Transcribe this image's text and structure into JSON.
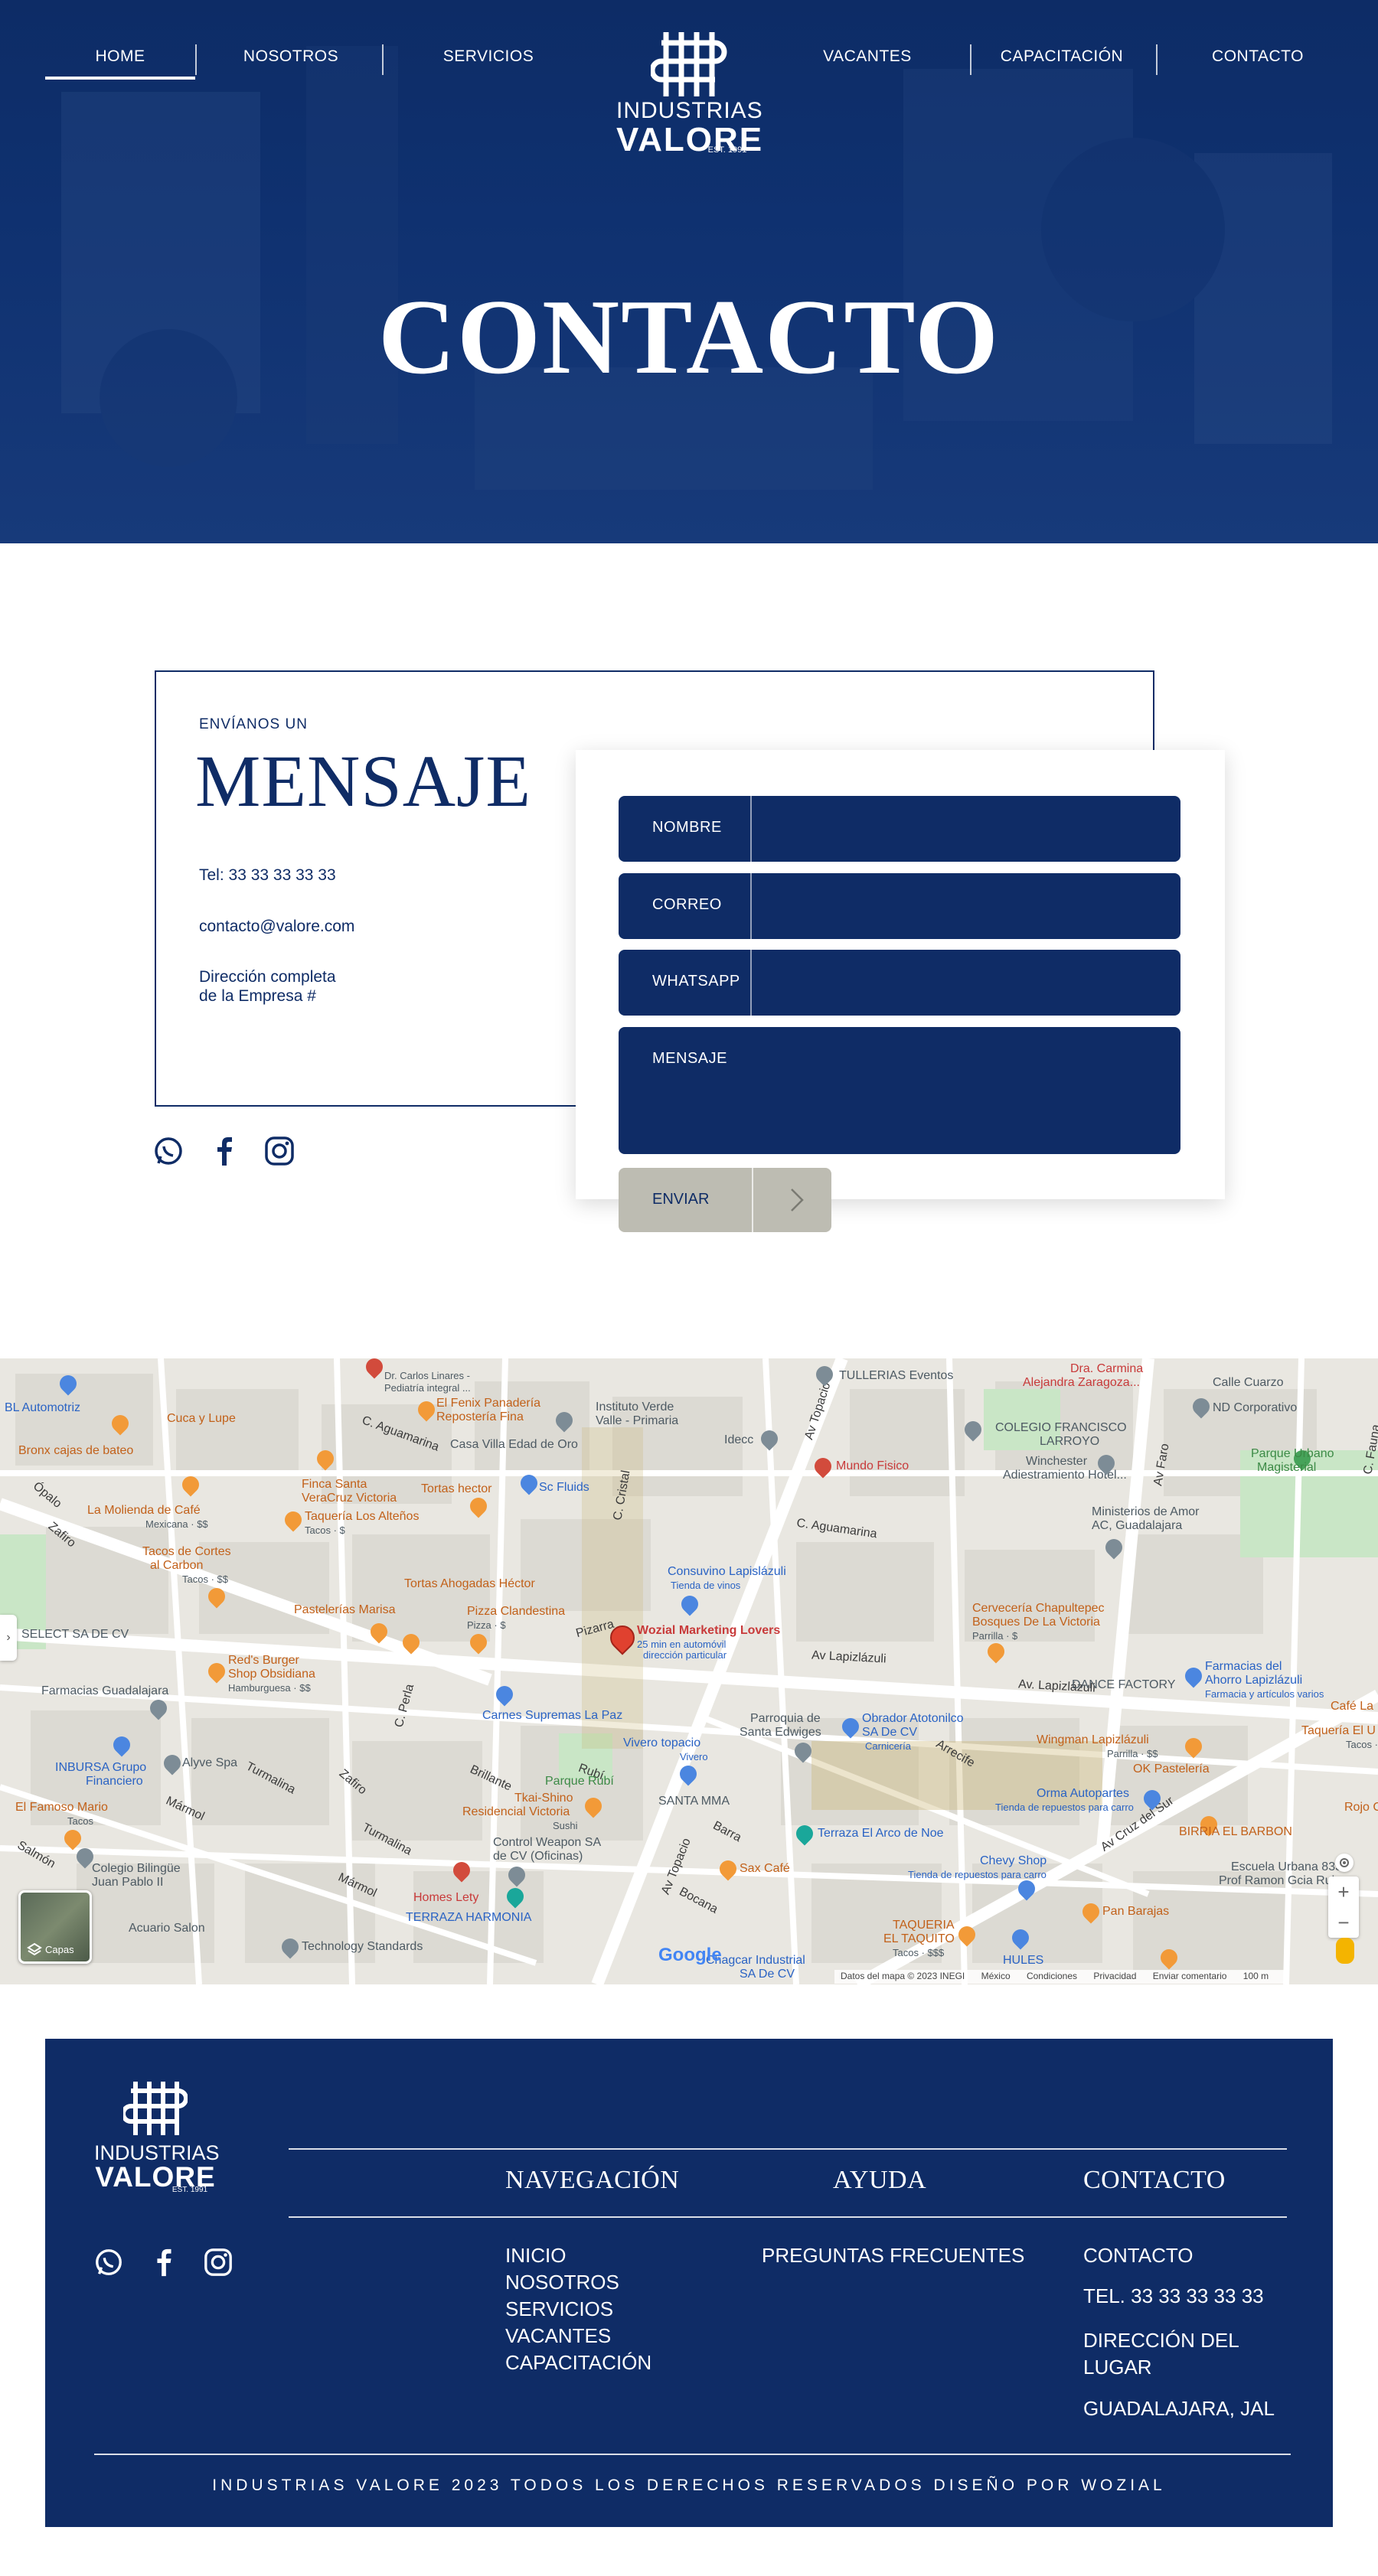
{
  "nav": {
    "items": [
      {
        "label": "HOME",
        "active": true
      },
      {
        "label": "NOSOTROS"
      },
      {
        "label": "SERVICIOS"
      },
      {
        "label": "VACANTES"
      },
      {
        "label": "CAPACITACIÓN"
      },
      {
        "label": "CONTACTO"
      }
    ]
  },
  "logo": {
    "line1": "INDUSTRIAS",
    "line2": "VALORE",
    "est": "EST. 1991"
  },
  "hero": {
    "title": "CONTACTO"
  },
  "contact": {
    "eyebrow": "ENVÍANOS UN",
    "title": "MENSAJE",
    "tel": "Tel: 33 33 33 33 33",
    "email": "contacto@valore.com",
    "address_line1": "Dirección completa",
    "address_line2": "de la Empresa #",
    "social": [
      "whatsapp-icon",
      "facebook-icon",
      "instagram-icon"
    ]
  },
  "form": {
    "fields": [
      {
        "label": "NOMBRE",
        "value": ""
      },
      {
        "label": "CORREO",
        "value": ""
      },
      {
        "label": "WHATSAPP",
        "value": ""
      },
      {
        "label": "MENSAJE",
        "value": ""
      }
    ],
    "submit": "ENVIAR"
  },
  "map": {
    "marker_title": "Wozial Marketing Lovers",
    "marker_sub1": "25 min en automóvil",
    "marker_sub2": "dirección particular",
    "layers_label": "Capas",
    "brand": "Google",
    "footer": [
      "Datos del mapa © 2023 INEGI",
      "México",
      "Condiciones",
      "Privacidad",
      "Enviar comentario",
      "100 m"
    ],
    "labels": [
      {
        "t": "Dr. Carlos Linares -",
        "c": "g"
      },
      {
        "t": "Pediatría integral ...",
        "c": "g"
      },
      {
        "t": "El Fenix Panadería",
        "c": "o"
      },
      {
        "t": "Repostería Fina",
        "c": "o"
      },
      {
        "t": "Instituto Verde",
        "c": "g"
      },
      {
        "t": "Valle - Primaria",
        "c": "g"
      },
      {
        "t": "TULLERIAS Eventos",
        "c": "g"
      },
      {
        "t": "Dra. Carmina",
        "c": "r"
      },
      {
        "t": "Alejandra Zaragoza...",
        "c": "r"
      },
      {
        "t": "Calle Cuarzo",
        "c": "g"
      },
      {
        "t": "ND Corporativo",
        "c": "g"
      },
      {
        "t": "BL Automotriz",
        "c": "b"
      },
      {
        "t": "Cuca y Lupe",
        "c": "o"
      },
      {
        "t": "Casa Villa Edad de Oro",
        "c": "g"
      },
      {
        "t": "Idecc",
        "c": "g"
      },
      {
        "t": "COLEGIO FRANCISCO",
        "c": "g"
      },
      {
        "t": "LARROYO",
        "c": "g"
      },
      {
        "t": "Parque Urbano",
        "c": "gr"
      },
      {
        "t": "Magisterial",
        "c": "gr"
      },
      {
        "t": "Bronx cajas de bateo",
        "c": "o"
      },
      {
        "t": "Mundo Fisico",
        "c": "r"
      },
      {
        "t": "Winchester",
        "c": "g"
      },
      {
        "t": "Adiestramiento Hotel...",
        "c": "g"
      },
      {
        "t": "Finca Santa",
        "c": "o"
      },
      {
        "t": "VeraCruz Victoria",
        "c": "o"
      },
      {
        "t": "Tortas hector",
        "c": "o"
      },
      {
        "t": "Sc Fluids",
        "c": "b"
      },
      {
        "t": "La Molienda de Café",
        "c": "o"
      },
      {
        "t": "Mexicana · $$",
        "c": "g"
      },
      {
        "t": "Taquería Los Alteños",
        "c": "o"
      },
      {
        "t": "Tacos · $",
        "c": "g"
      },
      {
        "t": "Ministerios de Amor",
        "c": "g"
      },
      {
        "t": "AC, Guadalajara",
        "c": "g"
      },
      {
        "t": "Tacos de Cortes",
        "c": "o"
      },
      {
        "t": "al Carbon",
        "c": "o"
      },
      {
        "t": "Tacos · $$",
        "c": "g"
      },
      {
        "t": "Consuvino Lapislázuli",
        "c": "b"
      },
      {
        "t": "Tienda de vinos",
        "c": "b"
      },
      {
        "t": "Tortas Ahogadas Héctor",
        "c": "o"
      },
      {
        "t": "Pastelerías Marisa",
        "c": "o"
      },
      {
        "t": "Pizza Clandestina",
        "c": "o"
      },
      {
        "t": "Pizza · $",
        "c": "g"
      },
      {
        "t": "Cervecería Chapultepec",
        "c": "o"
      },
      {
        "t": "Bosques De La Victoria",
        "c": "o"
      },
      {
        "t": "Parrilla · $",
        "c": "g"
      },
      {
        "t": "SELECT SA DE CV",
        "c": "g"
      },
      {
        "t": "Red's Burger",
        "c": "o"
      },
      {
        "t": "Shop Obsidiana",
        "c": "o"
      },
      {
        "t": "Hamburguesa · $$",
        "c": "g"
      },
      {
        "t": "Farmacias del",
        "c": "b"
      },
      {
        "t": "Ahorro Lapizlázuli",
        "c": "b"
      },
      {
        "t": "Farmacia y artículos varios",
        "c": "b"
      },
      {
        "t": "Farmacias Guadalajara",
        "c": "g"
      },
      {
        "t": "DANCE FACTORY",
        "c": "g"
      },
      {
        "t": "Café La",
        "c": "o"
      },
      {
        "t": "Carnes Supremas La Paz",
        "c": "b"
      },
      {
        "t": "Obrador Atotonilco",
        "c": "b"
      },
      {
        "t": "SA De CV",
        "c": "b"
      },
      {
        "t": "Carnicería",
        "c": "b"
      },
      {
        "t": "Taquería El U",
        "c": "o"
      },
      {
        "t": "Tacos · $",
        "c": "g"
      },
      {
        "t": "Parroquia de",
        "c": "g"
      },
      {
        "t": "Santa Edwiges",
        "c": "g"
      },
      {
        "t": "Wingman Lapizlázuli",
        "c": "o"
      },
      {
        "t": "Parrilla · $$",
        "c": "g"
      },
      {
        "t": "OK Pastelería",
        "c": "o"
      },
      {
        "t": "Vivero topacio",
        "c": "b"
      },
      {
        "t": "Vivero",
        "c": "b"
      },
      {
        "t": "INBURSA Grupo",
        "c": "b"
      },
      {
        "t": "Financiero",
        "c": "b"
      },
      {
        "t": "Alyve Spa",
        "c": "g"
      },
      {
        "t": "Parque Rubí",
        "c": "gr"
      },
      {
        "t": "Tkai-Shino",
        "c": "o"
      },
      {
        "t": "Residencial Victoria",
        "c": "o"
      },
      {
        "t": "Sushi",
        "c": "g"
      },
      {
        "t": "SANTA MMA",
        "c": "g"
      },
      {
        "t": "Orma Autopartes",
        "c": "b"
      },
      {
        "t": "Tienda de repuestos para carro",
        "c": "b"
      },
      {
        "t": "Rojo C",
        "c": "o"
      },
      {
        "t": "El Famoso Mario",
        "c": "o"
      },
      {
        "t": "Tacos",
        "c": "g"
      },
      {
        "t": "BIRRIA EL BARBON",
        "c": "o"
      },
      {
        "t": "Control Weapon SA",
        "c": "g"
      },
      {
        "t": "de CV (Oficinas)",
        "c": "g"
      },
      {
        "t": "Terraza El Arco de Noe",
        "c": "b"
      },
      {
        "t": "Colegio Bilingüe",
        "c": "g"
      },
      {
        "t": "Juan Pablo II",
        "c": "g"
      },
      {
        "t": "Sax Café",
        "c": "o"
      },
      {
        "t": "Chevy Shop",
        "c": "b"
      },
      {
        "t": "Tienda de repuestos para carro",
        "c": "b"
      },
      {
        "t": "Escuela Urbana 833",
        "c": "g"
      },
      {
        "t": "Prof Ramon Gcia Ruiz",
        "c": "g"
      },
      {
        "t": "Homes Lety",
        "c": "r"
      },
      {
        "t": "TERRAZA HARMONIA",
        "c": "b"
      },
      {
        "t": "Pan Barajas",
        "c": "o"
      },
      {
        "t": "Acuario Salon",
        "c": "g"
      },
      {
        "t": "Technology Standards",
        "c": "g"
      },
      {
        "t": "TAQUERIA",
        "c": "o"
      },
      {
        "t": "EL TAQUITO",
        "c": "o"
      },
      {
        "t": "Tacos · $$$",
        "c": "g"
      },
      {
        "t": "HULES",
        "c": "b"
      },
      {
        "t": "Chagcar Industrial",
        "c": "b"
      },
      {
        "t": "SA De CV",
        "c": "b"
      }
    ],
    "roads": [
      "Av Topacio",
      "C. Aguamarina",
      "C. Cristal",
      "C. Aguamarina",
      "Av Lapizlázuli",
      "Av. Lapizlázuli",
      "Zafiro",
      "Ópalo",
      "Pizarra",
      "C. Perla",
      "Turmalina",
      "Mármol",
      "Brillante",
      "Rubí",
      "Barra",
      "Bocana",
      "Av Topacio",
      "Arrecife",
      "Av Cruz del Sur",
      "Av Faro",
      "C. Fauna",
      "Turmalina",
      "Mármol",
      "Zafiro",
      "Salmón"
    ]
  },
  "footer": {
    "logo": {
      "line1": "INDUSTRIAS",
      "line2": "VALORE",
      "est": "EST. 1991"
    },
    "headings": {
      "nav": "NAVEGACIÓN",
      "help": "AYUDA",
      "contact": "CONTACTO"
    },
    "nav_links": [
      "INICIO",
      "NOSOTROS",
      "SERVICIOS",
      "VACANTES",
      "CAPACITACIÓN"
    ],
    "help_links": [
      "PREGUNTAS FRECUENTES"
    ],
    "contact_links": [
      "CONTACTO",
      "TEL. 33 33 33 33 33",
      "DIRECCIÓN DEL",
      "LUGAR",
      "GUADALAJARA, JAL"
    ],
    "copyright": "INDUSTRIAS VALORE 2023 TODOS LOS DERECHOS RESERVADOS DISEÑO POR WOZIAL"
  },
  "colors": {
    "navy": "#0f2c66",
    "beige": "#bdbcb2",
    "white": "#ffffff"
  }
}
